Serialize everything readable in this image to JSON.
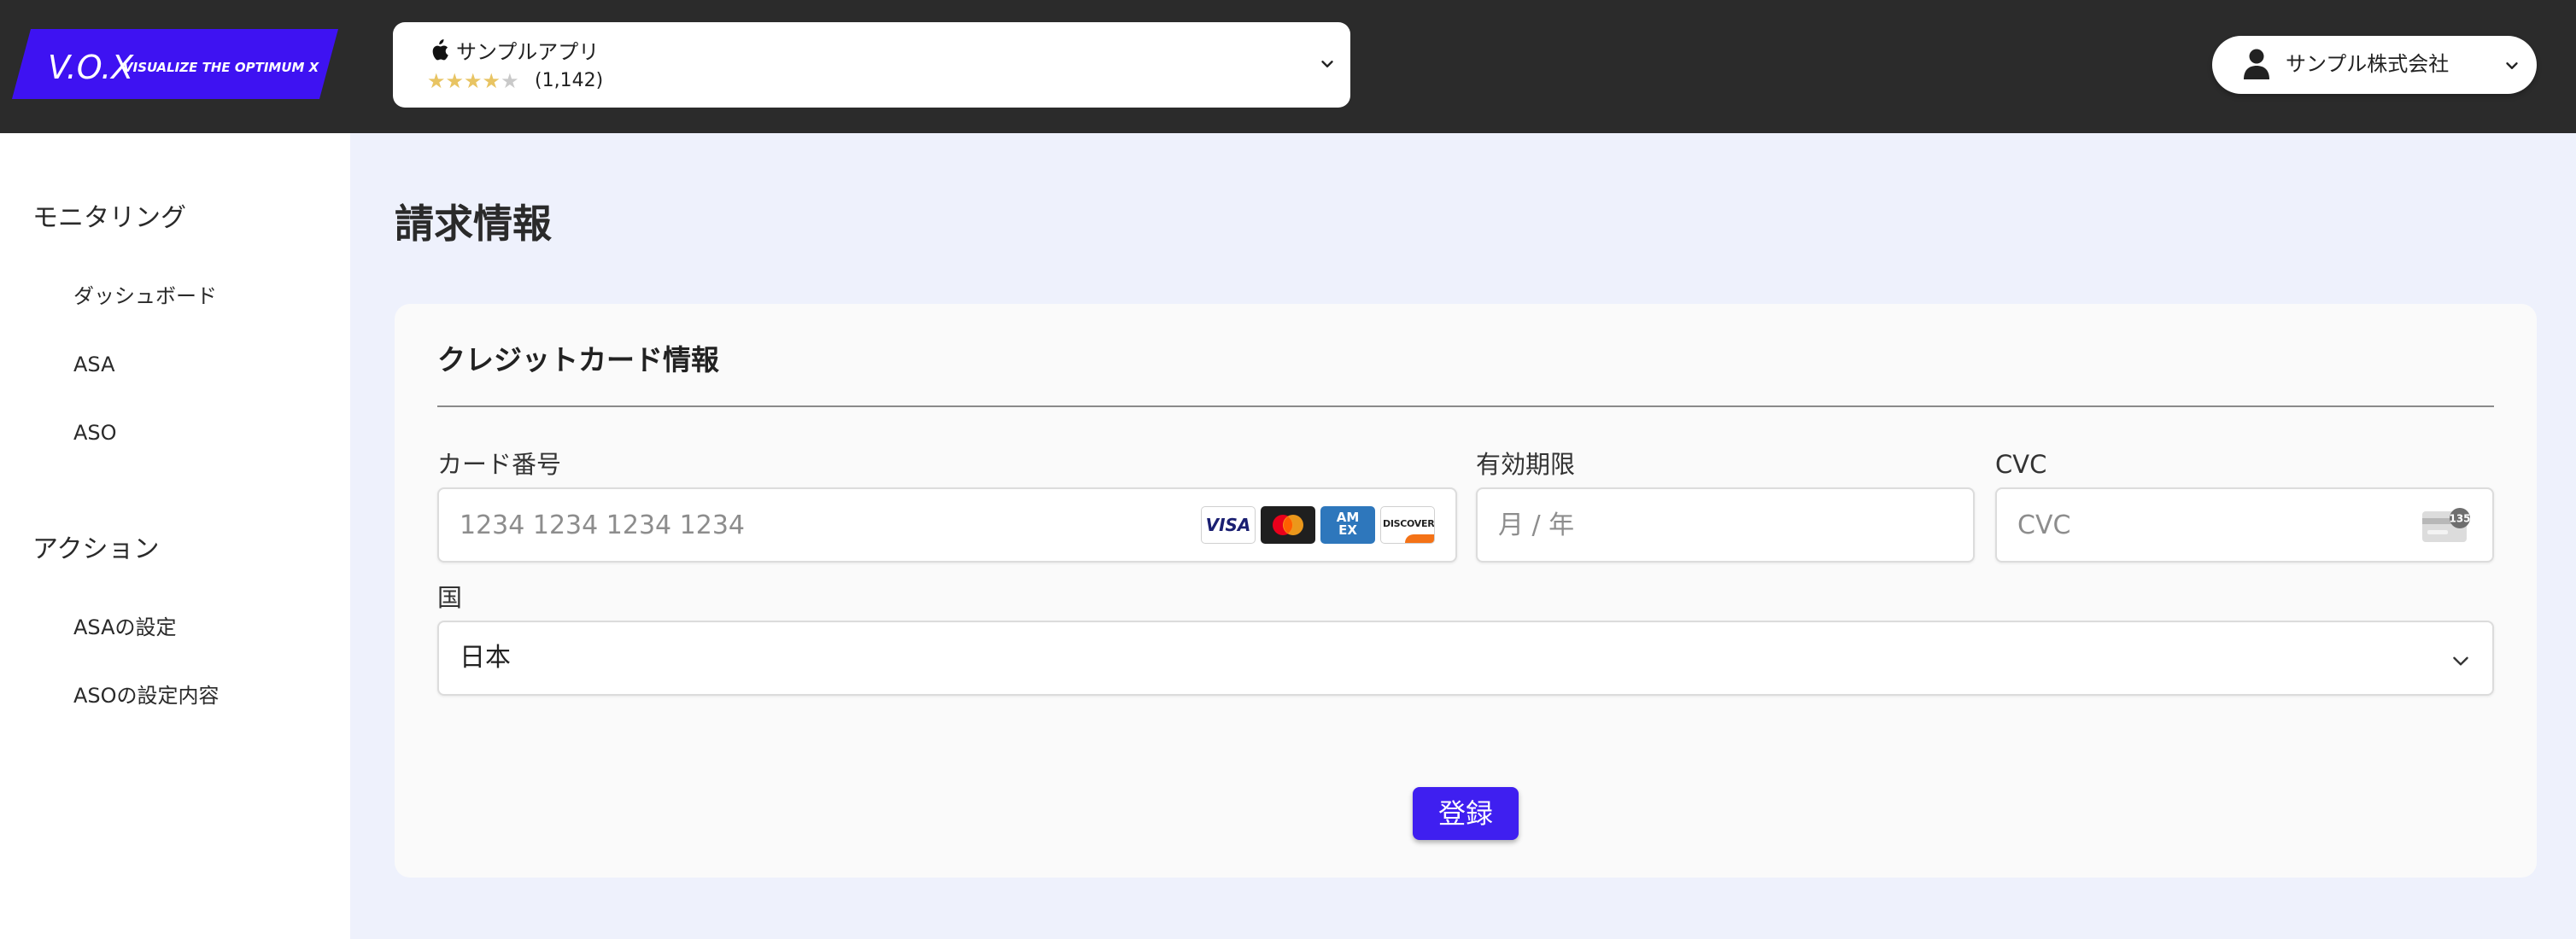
{
  "header": {
    "logo": {
      "brand": "V.O.X",
      "tagline": "VISUALIZE THE OPTIMUM X",
      "color": "#3e12f2"
    },
    "app_selector": {
      "icon": "apple-icon",
      "app_name": "サンプルアプリ",
      "star_rating": 4,
      "stars_max": 5,
      "rating_count": "(1,142)"
    },
    "company_selector": {
      "icon": "user-icon",
      "name": "サンプル株式会社"
    }
  },
  "sidebar": {
    "sections": [
      {
        "heading": "モニタリング",
        "items": [
          "ダッシュボード",
          "ASA",
          "ASO"
        ]
      },
      {
        "heading": "アクション",
        "items": [
          "ASAの設定",
          "ASOの設定内容"
        ]
      }
    ]
  },
  "main": {
    "page_title": "請求情報",
    "card": {
      "title": "クレジットカード情報",
      "card_number": {
        "label": "カード番号",
        "placeholder": "1234 1234 1234 1234",
        "brands": [
          "VISA",
          "mastercard",
          "AMEX",
          "DISCOVER"
        ]
      },
      "expiry": {
        "label": "有効期限",
        "placeholder": "月 / 年"
      },
      "cvc": {
        "label": "CVC",
        "placeholder": "CVC",
        "icon_badge": "135"
      },
      "country": {
        "label": "国",
        "value": "日本"
      },
      "submit_label": "登録"
    }
  },
  "colors": {
    "topbar": "#2b2b2b",
    "accent": "#3f1ff0",
    "page_bg": "#eef1fc",
    "card_bg": "#fafafa",
    "star": "#e8c463"
  }
}
